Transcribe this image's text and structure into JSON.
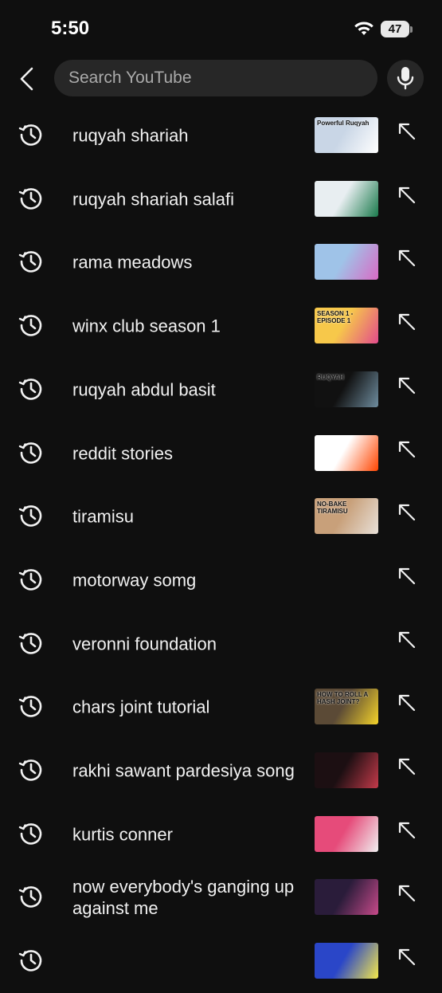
{
  "status": {
    "time": "5:50",
    "battery": "47"
  },
  "search": {
    "placeholder": "Search YouTube"
  },
  "suggestions": [
    {
      "label": "ruqyah shariah",
      "thumb_text": "Powerful Ruqyah",
      "thumb_colors": [
        "#c9d6e6",
        "#ffffff"
      ]
    },
    {
      "label": "ruqyah shariah salafi",
      "thumb_text": "",
      "thumb_colors": [
        "#e8eef1",
        "#1a7a4c"
      ]
    },
    {
      "label": "rama meadows",
      "thumb_text": "",
      "thumb_colors": [
        "#9fc3e8",
        "#d96ac4"
      ]
    },
    {
      "label": "winx club season 1",
      "thumb_text": "SEASON 1 - EPISODE 1",
      "thumb_colors": [
        "#f7c84a",
        "#e24b8c"
      ]
    },
    {
      "label": "ruqyah abdul basit",
      "thumb_text": "RUQYAH",
      "thumb_colors": [
        "#111111",
        "#6e8c9e"
      ]
    },
    {
      "label": "reddit stories",
      "thumb_text": "",
      "thumb_colors": [
        "#ffffff",
        "#ff4500"
      ]
    },
    {
      "label": "tiramisu",
      "thumb_text": "NO-BAKE TIRAMISU",
      "thumb_colors": [
        "#c8a07a",
        "#e8e0d8"
      ]
    },
    {
      "label": "motorway somg",
      "thumb_text": "",
      "thumb_colors": null
    },
    {
      "label": "veronni foundation",
      "thumb_text": "",
      "thumb_colors": null
    },
    {
      "label": "chars joint tutorial",
      "thumb_text": "HOW TO ROLL A HASH JOINT?",
      "thumb_colors": [
        "#5b4a36",
        "#f4d32a"
      ]
    },
    {
      "label": "rakhi sawant pardesiya song",
      "thumb_text": "",
      "thumb_colors": [
        "#1c0f12",
        "#c43a4a"
      ]
    },
    {
      "label": "kurtis conner",
      "thumb_text": "",
      "thumb_colors": [
        "#e64b7a",
        "#f0f0f0"
      ]
    },
    {
      "label": "now everybody's ganging up against me",
      "thumb_text": "",
      "thumb_colors": [
        "#2a1c3a",
        "#c74a8a"
      ]
    },
    {
      "label": "",
      "thumb_text": "",
      "thumb_colors": [
        "#2a46c8",
        "#f4e84a"
      ]
    }
  ]
}
